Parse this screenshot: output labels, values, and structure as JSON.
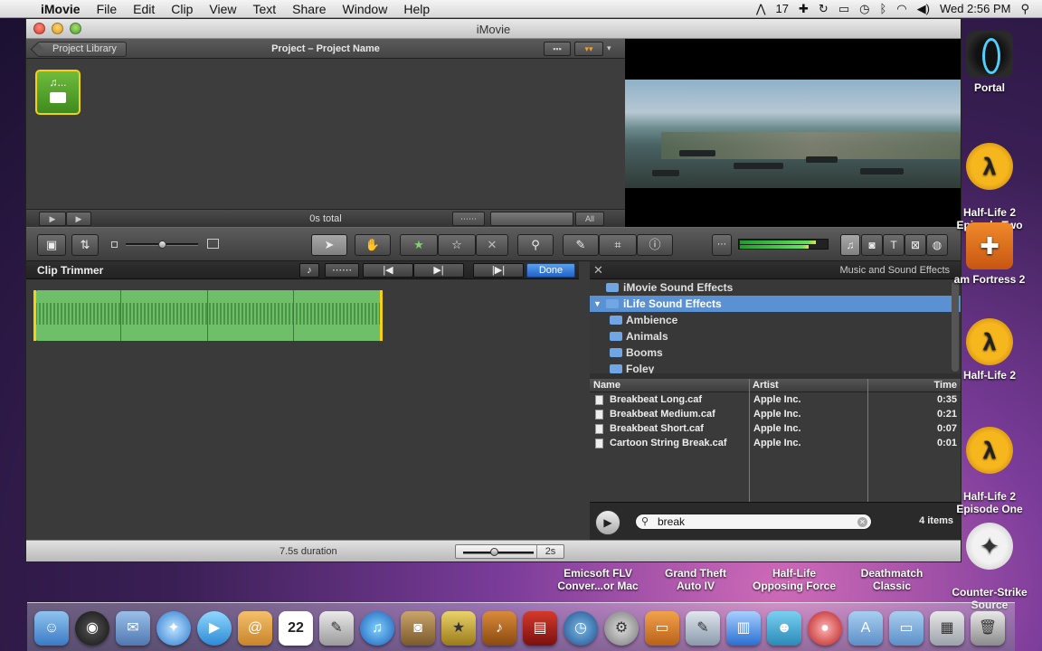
{
  "menubar": {
    "app": "iMovie",
    "items": [
      "File",
      "Edit",
      "Clip",
      "View",
      "Text",
      "Share",
      "Window",
      "Help"
    ],
    "status_number": "17",
    "clock": "Wed 2:56 PM"
  },
  "window": {
    "title": "iMovie",
    "project_library_label": "Project Library",
    "project_title": "Project – Project Name",
    "project_thumb_label": "♫...",
    "total_label": "0s total",
    "all_label": "All"
  },
  "trimmer": {
    "title": "Clip Trimmer",
    "done_label": "Done"
  },
  "music": {
    "panel_title": "Music and Sound Effects",
    "folders": [
      {
        "label": "iMovie Sound Effects",
        "selected": false,
        "indent": 0
      },
      {
        "label": "iLife Sound Effects",
        "selected": true,
        "indent": 0
      },
      {
        "label": "Ambience",
        "selected": false,
        "indent": 1
      },
      {
        "label": "Animals",
        "selected": false,
        "indent": 1
      },
      {
        "label": "Booms",
        "selected": false,
        "indent": 1
      },
      {
        "label": "Foley",
        "selected": false,
        "indent": 1
      }
    ],
    "columns": {
      "name": "Name",
      "artist": "Artist",
      "time": "Time"
    },
    "rows": [
      {
        "name": "Breakbeat Long.caf",
        "artist": "Apple Inc.",
        "time": "0:35"
      },
      {
        "name": "Breakbeat Medium.caf",
        "artist": "Apple Inc.",
        "time": "0:21"
      },
      {
        "name": "Breakbeat Short.caf",
        "artist": "Apple Inc.",
        "time": "0:07"
      },
      {
        "name": "Cartoon String Break.caf",
        "artist": "Apple Inc.",
        "time": "0:01"
      }
    ],
    "search_value": "break",
    "count_label": "4 items"
  },
  "status": {
    "duration": "7.5s duration",
    "zoom_value": "2s"
  },
  "desktop": {
    "icons": [
      "Portal",
      "Half-Life 2\nEpisode Two",
      "am Fortress 2",
      "Half-Life 2",
      "Half-Life 2\nEpisode One",
      "Counter-Strike\nSource"
    ]
  },
  "dock": {
    "labels": [
      "Emicsoft FLV\nConver...or Mac",
      "Grand Theft\nAuto IV",
      "Half-Life\nOpposing Force",
      "Deathmatch\nClassic",
      "Counter-Strike\nSource"
    ],
    "calendar_day": "22"
  },
  "colors": {
    "selection": "#5a91d3",
    "done_button": "#2a72d6",
    "clip_green": "#6fbf6a",
    "trim_handle": "#f5d10f"
  }
}
